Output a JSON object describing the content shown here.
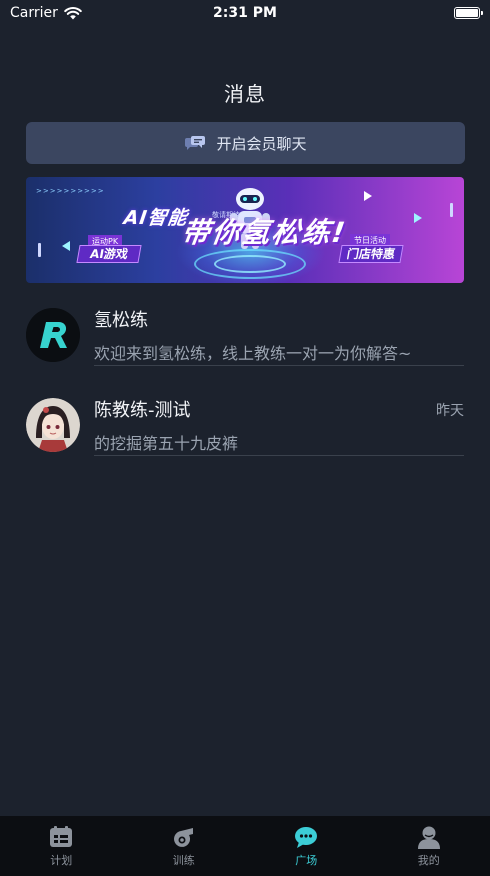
{
  "status_bar": {
    "carrier": "Carrier",
    "time": "2:31 PM"
  },
  "header": {
    "title": "消息"
  },
  "vip_chat": {
    "label": "开启会员聊天",
    "icon": "chat-bubbles-icon"
  },
  "banner": {
    "title_small": "AI智能",
    "title_big": "带你氢松练!",
    "invite": "敬请期待",
    "left_tag_small": "运动PK",
    "left_tag_big": "AI游戏",
    "right_tag_small": "节日活动",
    "right_tag_big": "门店特惠",
    "arrows": ">>>>>>>>>>"
  },
  "messages": [
    {
      "name": "氢松练",
      "preview": "欢迎来到氢松练，线上教练一对一为你解答~",
      "time": "",
      "avatar": "app-logo-icon"
    },
    {
      "name": "陈教练-测试",
      "preview": "的挖掘第五十九皮裤",
      "time": "昨天",
      "avatar": "anime-girl-avatar"
    }
  ],
  "tabs": [
    {
      "label": "计划",
      "icon": "calendar-icon",
      "active": false
    },
    {
      "label": "训练",
      "icon": "whistle-icon",
      "active": false
    },
    {
      "label": "广场",
      "icon": "chat-bubble-icon",
      "active": true
    },
    {
      "label": "我的",
      "icon": "profile-icon",
      "active": false
    }
  ],
  "colors": {
    "background": "#1c222d",
    "accent": "#3ccdd6",
    "vip_button": "#3b4660",
    "tab_bar": "#0c0e12"
  }
}
